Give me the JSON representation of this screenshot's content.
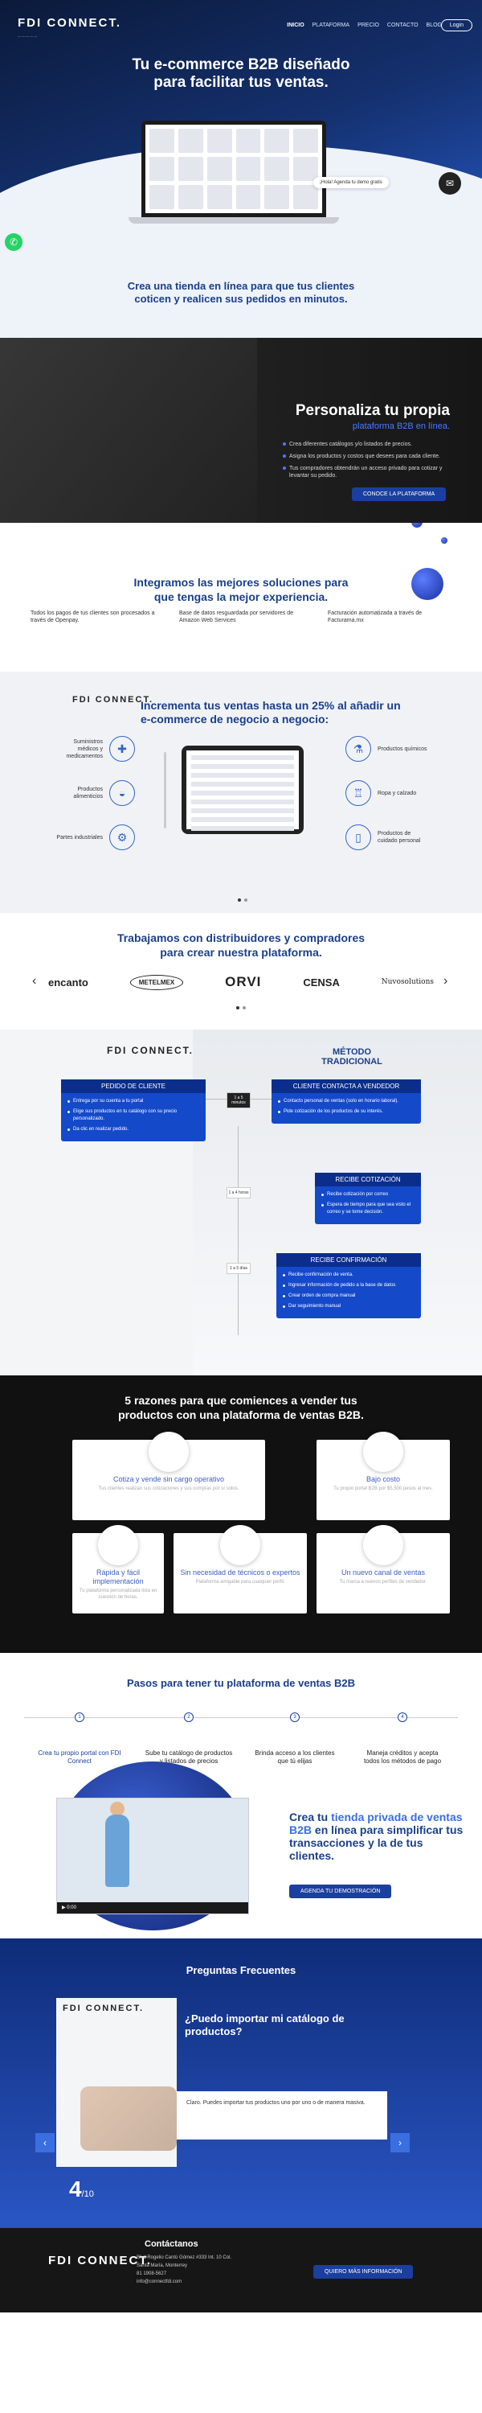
{
  "nav": {
    "logo": "FDI CONNECT.",
    "logo_tagline": "—————",
    "items": [
      "INICIO",
      "PLATAFORMA",
      "PRECIO",
      "CONTACTO",
      "BLOG"
    ],
    "login": "Login"
  },
  "hero": {
    "title_line1": "Tu e-commerce B2B diseñado",
    "title_line2": "para facilitar tus ventas.",
    "chat_prompt": "¡Hola! Agenda tu demo gratis",
    "subtitle_line1": "Crea una tienda en línea para que tus clientes",
    "subtitle_line2": "coticen y realicen sus pedidos en minutos."
  },
  "personaliza": {
    "title": "Personaliza tu propia",
    "lead": "plataforma B2B en línea.",
    "bullets": [
      "Crea diferentes catálogos y/o listados de precios.",
      "Asigna los productos y costos que desees para cada cliente.",
      "Tus compradores obtendrán un acceso privado para cotizar y levantar su pedido."
    ],
    "button": "CONOCE LA PLATAFORMA"
  },
  "integramos": {
    "title_line1": "Integramos las mejores soluciones para",
    "title_line2": "que tengas la mejor experiencia.",
    "cols": [
      "Todos los pagos de tus clientes son procesados a través de Openpay.",
      "Base de datos resguardada por servidores de Amazon Web Services",
      "Facturación automatizada a través de Facturama.mx"
    ]
  },
  "incrementa": {
    "logo": "FDI CONNECT.",
    "title_line1": "Incrementa tus ventas hasta un 25% al añadir un",
    "title_line2": "e-commerce de negocio a negocio:",
    "left_industries": [
      "Suministros médicos y medicamentos",
      "Productos alimenticios",
      "Partes industriales"
    ],
    "right_industries": [
      "Productos químicos",
      "Ropa y calzado",
      "Productos de cuidado personal"
    ]
  },
  "partners": {
    "title_line1": "Trabajamos con distribuidores y compradores",
    "title_line2": "para crear nuestra plataforma.",
    "logos": [
      "encanto",
      "METELMEX",
      "ORVI",
      "CENSA",
      "Nuvosolutions"
    ],
    "prev": "‹",
    "next": "›"
  },
  "compare": {
    "logo": "FDI CONNECT.",
    "traditional_title_line1": "MÉTODO",
    "traditional_title_line2": "TRADICIONAL",
    "fdi_card": {
      "header": "PEDIDO DE CLIENTE",
      "items": [
        "Entrega por su cuenta a tu portal",
        "Elige sus productos en tu catálogo con su precio personalizado.",
        "Da clic en realizar pedido."
      ]
    },
    "trad_cards": [
      {
        "header": "CLIENTE CONTACTA A VENDEDOR",
        "items": [
          "Contacto personal de ventas (solo en horario laboral).",
          "Pide cotización de los productos de su interés."
        ]
      },
      {
        "header": "RECIBE COTIZACIÓN",
        "items": [
          "Recibe cotización por correo",
          "Espera de tiempo para que sea visto el correo y se tome decisión."
        ]
      },
      {
        "header": "RECIBE CONFIRMACIÓN",
        "items": [
          "Recibe confirmación de venta.",
          "Ingresar información de pedido a la base de datos",
          "Crear orden de compra manual",
          "Dar seguimiento manual"
        ]
      }
    ],
    "times": [
      "1 a 5 minutos",
      "1 a 4 horas",
      "1 a 5 días"
    ]
  },
  "razones": {
    "title_line1": "5 razones para que comiences a vender tus",
    "title_line2": "productos con una plataforma de ventas B2B.",
    "cards": [
      {
        "title": "Cotiza y vende sin cargo operativo",
        "desc": "Tus clientes realizan sus cotizaciones y sus compras por sí solos."
      },
      {
        "title": "Bajo costo",
        "desc": "Tu propio portal B2B por $5,500 pesos al mes."
      },
      {
        "title": "Rápida y fácil implementación",
        "desc": "Tu plataforma personalizada lista en cuestión de horas."
      },
      {
        "title": "Sin necesidad de técnicos o expertos",
        "desc": "Plataforma amigable para cualquier perfil."
      },
      {
        "title": "Un nuevo canal de ventas",
        "desc": "Tu marca a nuevos perfiles de vendedor."
      }
    ]
  },
  "pasos": {
    "title": "Pasos para tener tu plataforma de ventas B2B",
    "steps": [
      {
        "n": "1",
        "text": "Crea tu propio portal con FDI Connect"
      },
      {
        "n": "2",
        "text": "Sube tu catálogo de productos y listados de precios"
      },
      {
        "n": "3",
        "text": "Brinda acceso a los clientes que tú elijas"
      },
      {
        "n": "4",
        "text": "Maneja créditos y acepta todos los métodos de pago"
      }
    ],
    "video_time": "0:00",
    "cta_pre": "Crea tu ",
    "cta_highlight": "tienda privada de ventas B2B",
    "cta_post": " en línea para simplificar tus transacciones y la de tus clientes.",
    "button": "AGENDA TU DEMOSTRACIÓN"
  },
  "faq": {
    "title": "Preguntas Frecuentes",
    "logo": "FDI CONNECT.",
    "question": "¿Puedo importar mi catálogo de productos?",
    "answer": "Claro. Puedes importar tus productos uno por uno o de manera masiva.",
    "current": "4",
    "total": "/10",
    "prev": "‹",
    "next": "›"
  },
  "footer": {
    "logo": "FDI CONNECT.",
    "heading": "Contáctanos",
    "address_line1": "Blvd Rogelio Cantú Gómez #333 Int. 10 Col.",
    "address_line2": "Santa María, Monterrey",
    "phone": "81 1908-5627",
    "email": "info@connectfdi.com",
    "button": "QUIERO MÁS INFORMACIÓN"
  }
}
